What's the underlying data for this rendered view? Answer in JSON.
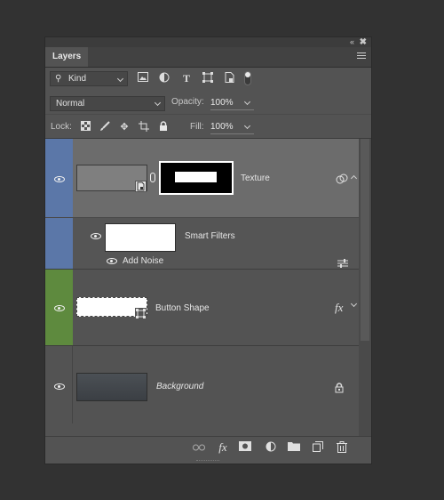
{
  "panel": {
    "tab_label": "Layers",
    "collapse_glyph": "«",
    "close_glyph": "✖"
  },
  "filter": {
    "kind_label": "Kind",
    "icons": [
      "image-filter-icon",
      "adjustment-filter-icon",
      "type-filter-icon",
      "shape-filter-icon",
      "smart-object-filter-icon"
    ]
  },
  "blend": {
    "mode": "Normal",
    "opacity_label": "Opacity:",
    "opacity_value": "100%"
  },
  "lock": {
    "label": "Lock:",
    "icons": [
      "lock-transparent-icon",
      "lock-image-icon",
      "lock-position-icon",
      "lock-artboard-icon",
      "lock-all-icon"
    ],
    "fill_label": "Fill:",
    "fill_value": "100%"
  },
  "layers": [
    {
      "name": "Texture",
      "color_label": "#5b77a8",
      "selected": true,
      "smart_object": true,
      "has_mask": true
    },
    {
      "name": "Smart Filters",
      "filter_effect": "Add Noise"
    },
    {
      "name": "Button Shape",
      "color_label": "#5e8a3e",
      "fx": "fx"
    },
    {
      "name": "Background",
      "locked": true
    }
  ],
  "bottom_bar": {
    "icons": [
      "link-layers-icon",
      "fx-icon",
      "add-mask-icon",
      "adjustment-layer-icon",
      "new-group-icon",
      "new-layer-icon",
      "delete-layer-icon"
    ],
    "fx_label": "fx"
  }
}
